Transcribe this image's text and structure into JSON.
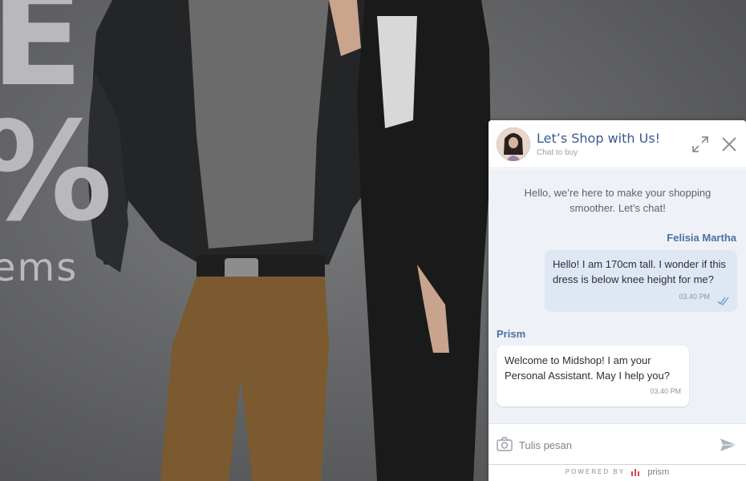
{
  "hero": {
    "text_line1": "E",
    "text_line2": "%",
    "text_line3": "ems"
  },
  "chat": {
    "title": "Let’s Shop with Us!",
    "subtitle": "Chat to buy",
    "intro": "Hello, we’re here to make your shopping smoother. Let’s chat!",
    "messages": [
      {
        "sender": "Felisia Martha",
        "text": "Hello! I am 170cm tall. I wonder if this dress is below knee height for me?",
        "time": "03.40 PM"
      },
      {
        "sender": "Prism",
        "text": "Welcome to Midshop! I am your Personal Assistant. May I help you?",
        "time": "03.40 PM"
      }
    ],
    "input_placeholder": "Tulis pesan",
    "footer_label": "POWERED BY",
    "footer_brand": "prism"
  },
  "colors": {
    "accent": "#3a5a8c",
    "name": "#4f6fa3",
    "user_bubble": "#dfe7f4",
    "body_bg": "#eef2f7"
  },
  "icons": [
    "expand-icon",
    "close-icon",
    "double-check-icon",
    "camera-icon",
    "send-icon",
    "prism-logo-icon"
  ]
}
